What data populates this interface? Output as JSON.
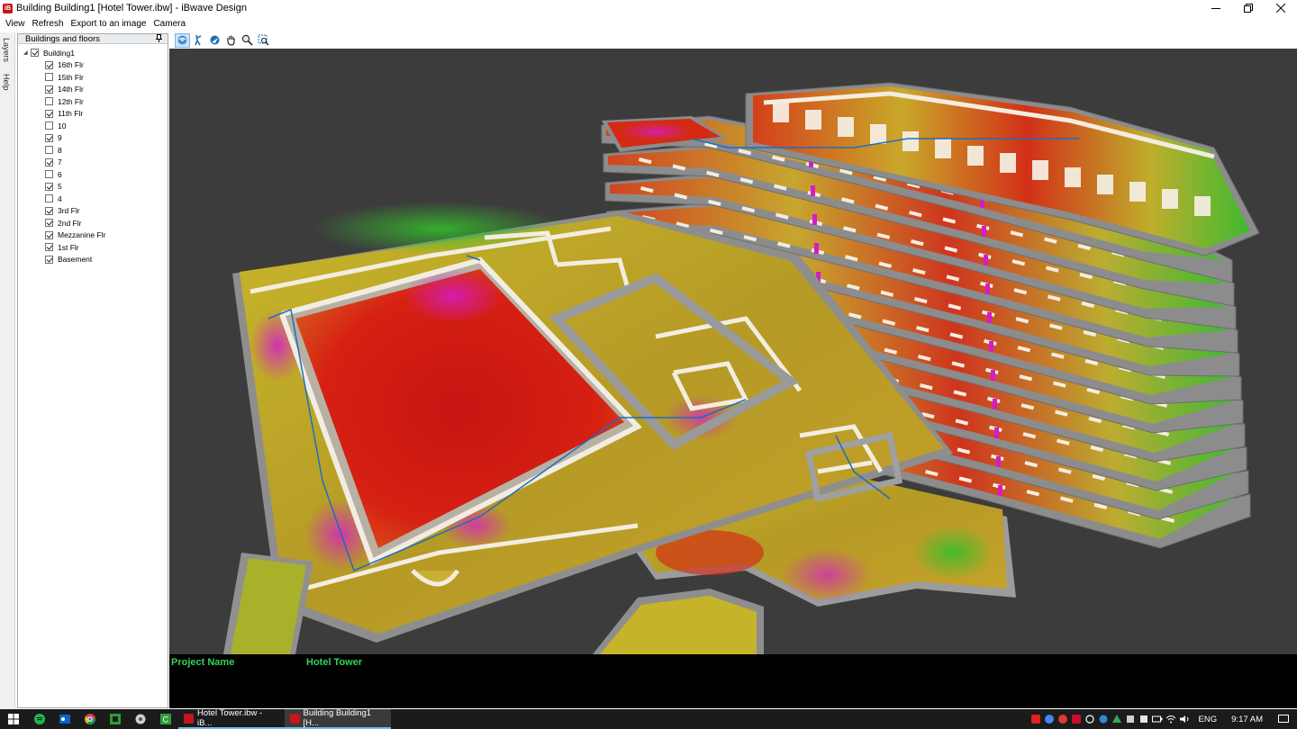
{
  "window": {
    "title": "Building Building1 [Hotel Tower.ibw] - iBwave Design",
    "app_icon": "iB",
    "controls": [
      "minimize-icon",
      "restore-icon",
      "close-icon"
    ]
  },
  "menu": [
    "View",
    "Refresh",
    "Export to an image",
    "Camera"
  ],
  "side_tabs": [
    "Layers",
    "Help"
  ],
  "panel": {
    "title": "Buildings and floors",
    "root": {
      "label": "Building1",
      "checked": true
    },
    "floors": [
      {
        "label": "16th Flr",
        "checked": true
      },
      {
        "label": "15th Flr",
        "checked": false
      },
      {
        "label": "14th Flr",
        "checked": true
      },
      {
        "label": "12th Flr",
        "checked": false
      },
      {
        "label": "11th Flr",
        "checked": true
      },
      {
        "label": "10",
        "checked": false
      },
      {
        "label": "9",
        "checked": true
      },
      {
        "label": "8",
        "checked": false
      },
      {
        "label": "7",
        "checked": true
      },
      {
        "label": "6",
        "checked": false
      },
      {
        "label": "5",
        "checked": true
      },
      {
        "label": "4",
        "checked": false
      },
      {
        "label": "3rd Flr",
        "checked": true
      },
      {
        "label": "2nd Flr",
        "checked": true
      },
      {
        "label": "Mezzanine Flr",
        "checked": true
      },
      {
        "label": "1st Flr",
        "checked": true
      },
      {
        "label": "Basement",
        "checked": true
      }
    ]
  },
  "toolbar": [
    "orbit-icon",
    "walk-icon",
    "fly-icon",
    "pan-icon",
    "zoom-icon",
    "zoom-extents-icon"
  ],
  "info": {
    "project_label": "Project Name",
    "project_value": "Hotel Tower"
  },
  "taskbar": {
    "tasks": [
      {
        "label": "Hotel Tower.ibw - iB...",
        "active": false
      },
      {
        "label": "Building Building1 [H...",
        "active": true
      }
    ],
    "language": "ENG",
    "time": "9:17 AM"
  },
  "colors": {
    "heat_red": "#d21a14",
    "heat_orange": "#e0641e",
    "heat_yellow": "#c8b228",
    "heat_green": "#35c02b",
    "heat_magenta": "#d51cc8",
    "wall": "#f3ede0",
    "slab": "#8a8a8a",
    "viewport_bg": "#3c3c3c",
    "info_text": "#33d35a"
  }
}
